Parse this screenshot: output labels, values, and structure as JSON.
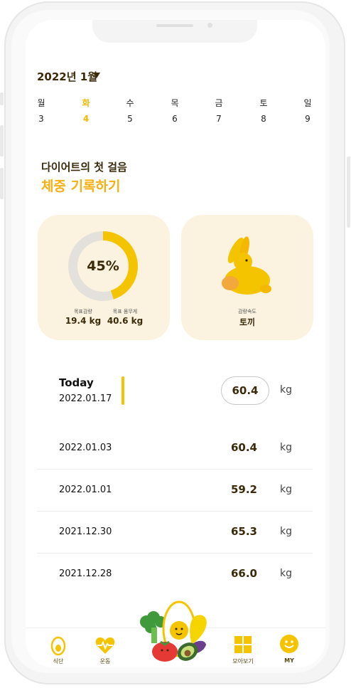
{
  "calendar": {
    "month_label": "2022년 1월",
    "days": [
      {
        "weekday": "월",
        "date": "3"
      },
      {
        "weekday": "화",
        "date": "4"
      },
      {
        "weekday": "수",
        "date": "5"
      },
      {
        "weekday": "목",
        "date": "6"
      },
      {
        "weekday": "금",
        "date": "7"
      },
      {
        "weekday": "토",
        "date": "8"
      },
      {
        "weekday": "일",
        "date": "9"
      }
    ]
  },
  "intro": {
    "subtitle": "다이어트의 첫 걸음",
    "headline": "체중 기록하기"
  },
  "progress_card": {
    "percent_label": "45%",
    "progress": 0.45,
    "goal_loss_label": "목표감량",
    "goal_loss_value": "19.4 kg",
    "goal_weight_label": "목표 몸무게",
    "goal_weight_value": "40.6 kg"
  },
  "speed_card": {
    "icon": "rabbit-icon",
    "label": "감량속도",
    "value": "토끼"
  },
  "today": {
    "title": "Today",
    "date": "2022.01.17",
    "weight": "60.4",
    "unit": "kg"
  },
  "records": [
    {
      "date": "2022.01.03",
      "weight": "60.4",
      "unit": "kg"
    },
    {
      "date": "2022.01.01",
      "weight": "59.2",
      "unit": "kg"
    },
    {
      "date": "2021.12.30",
      "weight": "65.3",
      "unit": "kg"
    },
    {
      "date": "2021.12.28",
      "weight": "66.0",
      "unit": "kg"
    }
  ],
  "tabbar": {
    "meal_label": "식단",
    "exercise_label": "운동",
    "collection_label": "모아보기",
    "my_label": "MY"
  },
  "colors": {
    "accent": "#f5c400",
    "headline": "#f5b014",
    "card_bg": "#fbf3df",
    "text_dark": "#3b2a0a"
  }
}
